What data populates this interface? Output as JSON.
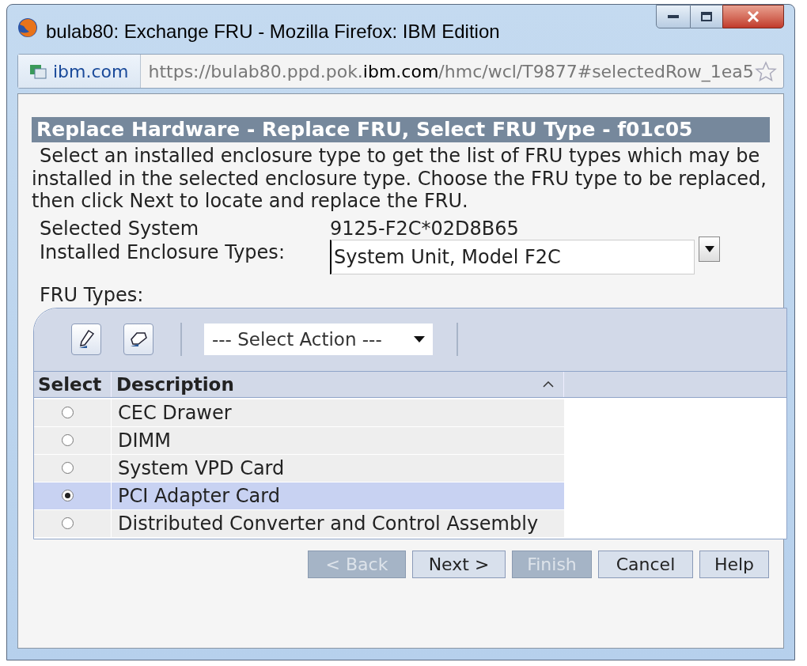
{
  "window": {
    "title": "bulab80: Exchange FRU - Mozilla Firefox: IBM Edition"
  },
  "address_bar": {
    "identity": "ibm.com",
    "url": "https://bulab80.ppd.pok.**ibm.com**/hmc/wcl/T9877#selectedRow_1ea5"
  },
  "header": "Replace Hardware - Replace FRU, Select FRU Type - f01c05",
  "instructions": "Select an installed enclosure type to get the list of FRU types which may be installed in the selected enclosure type. Choose the FRU type to be replaced, then click Next to locate and replace the FRU.",
  "fields": [
    {
      "kind": "text",
      "label": "Selected System",
      "value": "9125-F2C*02D8B65"
    },
    {
      "kind": "select",
      "label": "Installed Enclosure Types:",
      "value": "System Unit, Model F2C"
    }
  ],
  "fru_types_label": "FRU Types:",
  "table": {
    "action_select": "--- Select Action ---",
    "columns": [
      "Select",
      "Description"
    ],
    "rows": [
      {
        "description": "CEC Drawer",
        "selected": false
      },
      {
        "description": "DIMM",
        "selected": false
      },
      {
        "description": "System VPD Card",
        "selected": false
      },
      {
        "description": "PCI Adapter Card",
        "selected": true
      },
      {
        "description": "Distributed Converter and Control Assembly",
        "selected": false
      }
    ]
  },
  "buttons": [
    {
      "label": "< Back",
      "disabled": true
    },
    {
      "label": "Next >",
      "disabled": false
    },
    {
      "label": "Finish",
      "disabled": true
    },
    {
      "label": "Cancel",
      "disabled": false
    },
    {
      "label": "Help",
      "disabled": false
    }
  ]
}
